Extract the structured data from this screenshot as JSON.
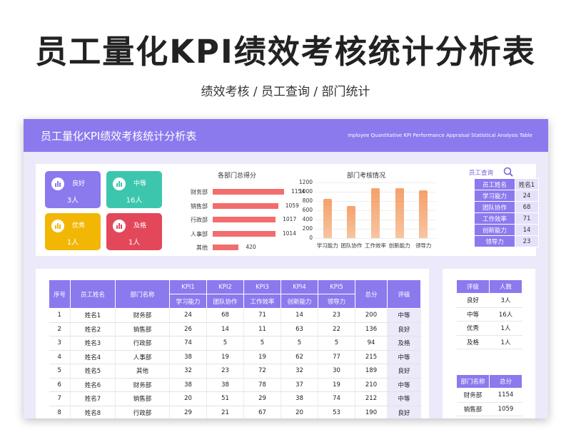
{
  "header": {
    "title": "员工量化KPI绩效考核统计分析表",
    "subtitle": "绩效考核 / 员工查询  / 部门统计"
  },
  "banner": {
    "title": "员工量化KPI绩效考核统计分析表",
    "subtitle": "mployee Quantitative KPI Performance Appraisal Statistical Analysis Table"
  },
  "colors": {
    "accent": "#8b79ee",
    "accent_light": "#ece9fb",
    "bar_red": "#f26d6d",
    "bar_orange": "#f6a06a"
  },
  "grade_cards": [
    {
      "label": "良好",
      "value": "3人",
      "color": "#8b79ee"
    },
    {
      "label": "中等",
      "value": "16人",
      "color": "#3cc6ae"
    },
    {
      "label": "优秀",
      "value": "1人",
      "color": "#f2b705"
    },
    {
      "label": "及格",
      "value": "1人",
      "color": "#e2485a"
    }
  ],
  "employee_lookup": {
    "search_label": "员工查询",
    "icon": "search-icon",
    "rows": [
      {
        "key": "员工姓名",
        "value": "姓名1"
      },
      {
        "key": "学习能力",
        "value": "24"
      },
      {
        "key": "团队协作",
        "value": "68"
      },
      {
        "key": "工作效率",
        "value": "71"
      },
      {
        "key": "创新能力",
        "value": "14"
      },
      {
        "key": "领导力",
        "value": "23"
      }
    ]
  },
  "chart_data": [
    {
      "type": "bar",
      "orientation": "horizontal",
      "title": "各部门总得分",
      "categories": [
        "财务部",
        "销售部",
        "行政部",
        "人事部",
        "其他"
      ],
      "values": [
        1154,
        1059,
        1017,
        1014,
        420
      ],
      "value_labels": [
        "1154",
        "1059",
        "1017",
        "1014",
        "420"
      ],
      "xlim": [
        0,
        1154
      ]
    },
    {
      "type": "bar",
      "title": "部门考核情况",
      "categories": [
        "学习能力",
        "团队协作",
        "工作效率",
        "创新能力",
        "领导力"
      ],
      "values": [
        840,
        700,
        1080,
        1070,
        1030
      ],
      "yticks": [
        "1200",
        "1000",
        "800",
        "600",
        "400",
        "200",
        "0"
      ],
      "ylim": [
        0,
        1200
      ],
      "grid": true
    }
  ],
  "main_table": {
    "headers": {
      "index": "序号",
      "name": "员工姓名",
      "dept": "部门名称",
      "kpi": [
        "KPI1",
        "KPI2",
        "KPI3",
        "KPI4",
        "KPI5"
      ],
      "kpi_sub": [
        "学习能力",
        "团队协作",
        "工作效率",
        "创新能力",
        "领导力"
      ],
      "total": "总分",
      "grade": "评级"
    },
    "rows": [
      [
        "1",
        "姓名1",
        "财务部",
        "24",
        "68",
        "71",
        "14",
        "23",
        "200",
        "中等"
      ],
      [
        "2",
        "姓名2",
        "销售部",
        "26",
        "14",
        "11",
        "63",
        "22",
        "136",
        "良好"
      ],
      [
        "3",
        "姓名3",
        "行政部",
        "74",
        "5",
        "5",
        "5",
        "5",
        "94",
        "及格"
      ],
      [
        "4",
        "姓名4",
        "人事部",
        "38",
        "19",
        "19",
        "62",
        "77",
        "215",
        "中等"
      ],
      [
        "5",
        "姓名5",
        "其他",
        "32",
        "23",
        "72",
        "32",
        "30",
        "189",
        "良好"
      ],
      [
        "6",
        "姓名6",
        "财务部",
        "38",
        "38",
        "78",
        "37",
        "19",
        "210",
        "中等"
      ],
      [
        "7",
        "姓名7",
        "销售部",
        "20",
        "51",
        "29",
        "38",
        "74",
        "212",
        "中等"
      ],
      [
        "8",
        "姓名8",
        "行政部",
        "29",
        "21",
        "67",
        "20",
        "53",
        "190",
        "良好"
      ]
    ]
  },
  "grade_table": {
    "headers": [
      "评级",
      "人数"
    ],
    "rows": [
      [
        "良好",
        "3人"
      ],
      [
        "中等",
        "16人"
      ],
      [
        "优秀",
        "1人"
      ],
      [
        "及格",
        "1人"
      ]
    ]
  },
  "dept_table": {
    "headers": [
      "部门名称",
      "总分"
    ],
    "rows": [
      [
        "财务部",
        "1154"
      ],
      [
        "销售部",
        "1059"
      ]
    ]
  }
}
